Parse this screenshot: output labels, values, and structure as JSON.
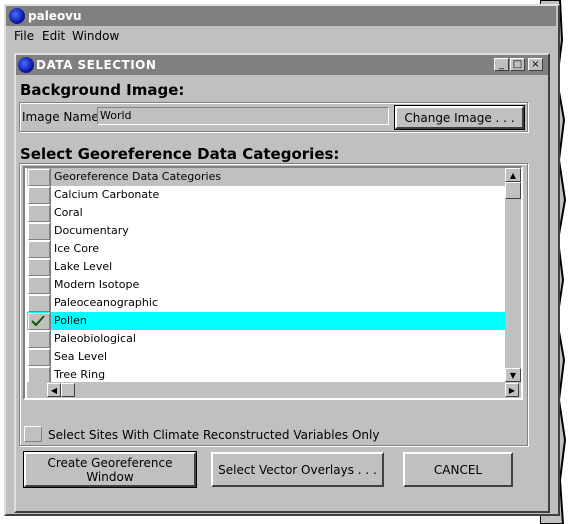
{
  "app": {
    "title": "paleovu",
    "menus": [
      "File",
      "Edit",
      "Window"
    ]
  },
  "dialog": {
    "title": "DATA SELECTION",
    "controls": {
      "minimize": "_",
      "maximize": "□",
      "close": "×"
    },
    "background_image_heading": "Background Image:",
    "image_name_label": "Image Name:",
    "image_name_value": "World",
    "change_image_button": "Change Image . . .",
    "categories_heading": "Select Georeference Data Categories:",
    "table_header": "Georeference Data Categories",
    "categories": [
      {
        "label": "Calcium Carbonate",
        "checked": false
      },
      {
        "label": "Coral",
        "checked": false
      },
      {
        "label": "Documentary",
        "checked": false
      },
      {
        "label": "Ice Core",
        "checked": false
      },
      {
        "label": "Lake Level",
        "checked": false
      },
      {
        "label": "Modern Isotope",
        "checked": false
      },
      {
        "label": "Paleoceanographic",
        "checked": false
      },
      {
        "label": "Pollen",
        "checked": true
      },
      {
        "label": "Paleobiological",
        "checked": false
      },
      {
        "label": "Sea Level",
        "checked": false
      },
      {
        "label": "Tree Ring",
        "checked": false
      }
    ],
    "climate_checkbox_label": "Select Sites With Climate Reconstructed Variables Only",
    "buttons": {
      "create": "Create Georeference Window",
      "vector": "Select Vector Overlays . . .",
      "cancel": "CANCEL"
    }
  },
  "colors": {
    "selected_row": "#00ffff",
    "title_bar": "#808080",
    "face": "#c0c0c0"
  }
}
